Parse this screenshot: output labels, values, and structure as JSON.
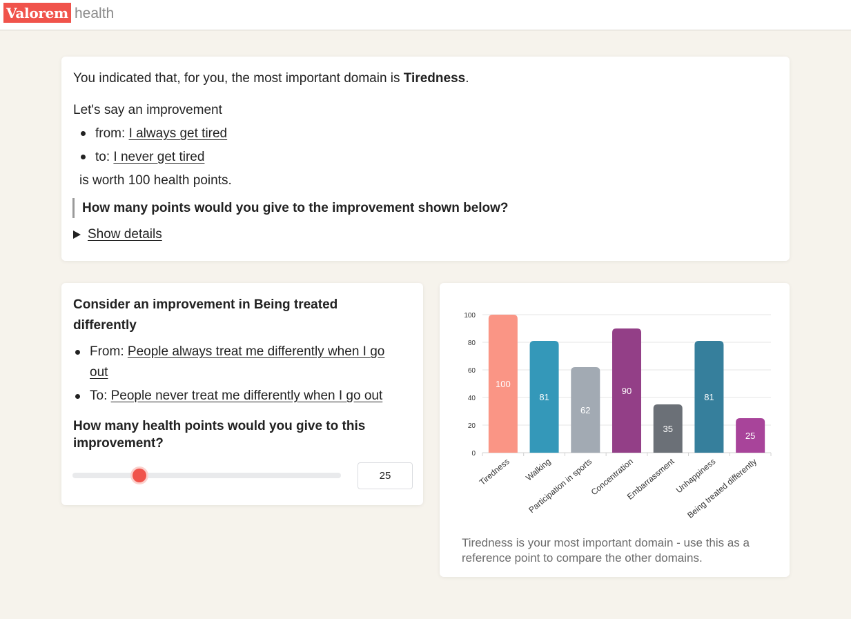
{
  "header": {
    "logo_text": "Valorem",
    "logo_sub": "health"
  },
  "intro": {
    "line1_prefix": "You indicated that, for you, the most important domain is ",
    "line1_domain": "Tiredness",
    "line1_suffix": ".",
    "line2": "Let's say an improvement",
    "from_label": "from: ",
    "from_value": "I always get tired",
    "to_label": "to: ",
    "to_value": "I never get tired",
    "worth": "is worth 100 health points.",
    "question": "How many points would you give to the improvement shown below?",
    "details_link": "Show details"
  },
  "improvement": {
    "heading_line1": "Consider an improvement in Being treated",
    "heading_line2": "differently",
    "from_label": "From: ",
    "from_value_line1": "People always treat me differently when I go",
    "from_value_line2": "out",
    "to_label": "To: ",
    "to_value": "People never treat me differently when I go out",
    "question_line1": "How many health points would you give to this",
    "question_line2": "improvement?",
    "slider_value": 25,
    "slider_min": 0,
    "slider_max": 100,
    "input_value": "25",
    "accent_color": "#f0534b"
  },
  "chart_data": {
    "type": "bar",
    "categories": [
      "Tiredness",
      "Walking",
      "Participation in sports",
      "Concentration",
      "Embarrassment",
      "Unhappiness",
      "Being treated differently"
    ],
    "values": [
      100,
      81,
      62,
      90,
      35,
      81,
      25
    ],
    "colors": [
      "#fa9585",
      "#3498b9",
      "#a2aab3",
      "#933f87",
      "#6b7077",
      "#367f9c",
      "#a8449a"
    ],
    "ylim": [
      0,
      100
    ],
    "yticks": [
      0,
      20,
      40,
      60,
      80,
      100
    ],
    "grid": true,
    "title": "",
    "xlabel": "",
    "ylabel": ""
  },
  "chart_caption": "Tiredness is your most important domain - use this as a reference point to compare the other domains."
}
